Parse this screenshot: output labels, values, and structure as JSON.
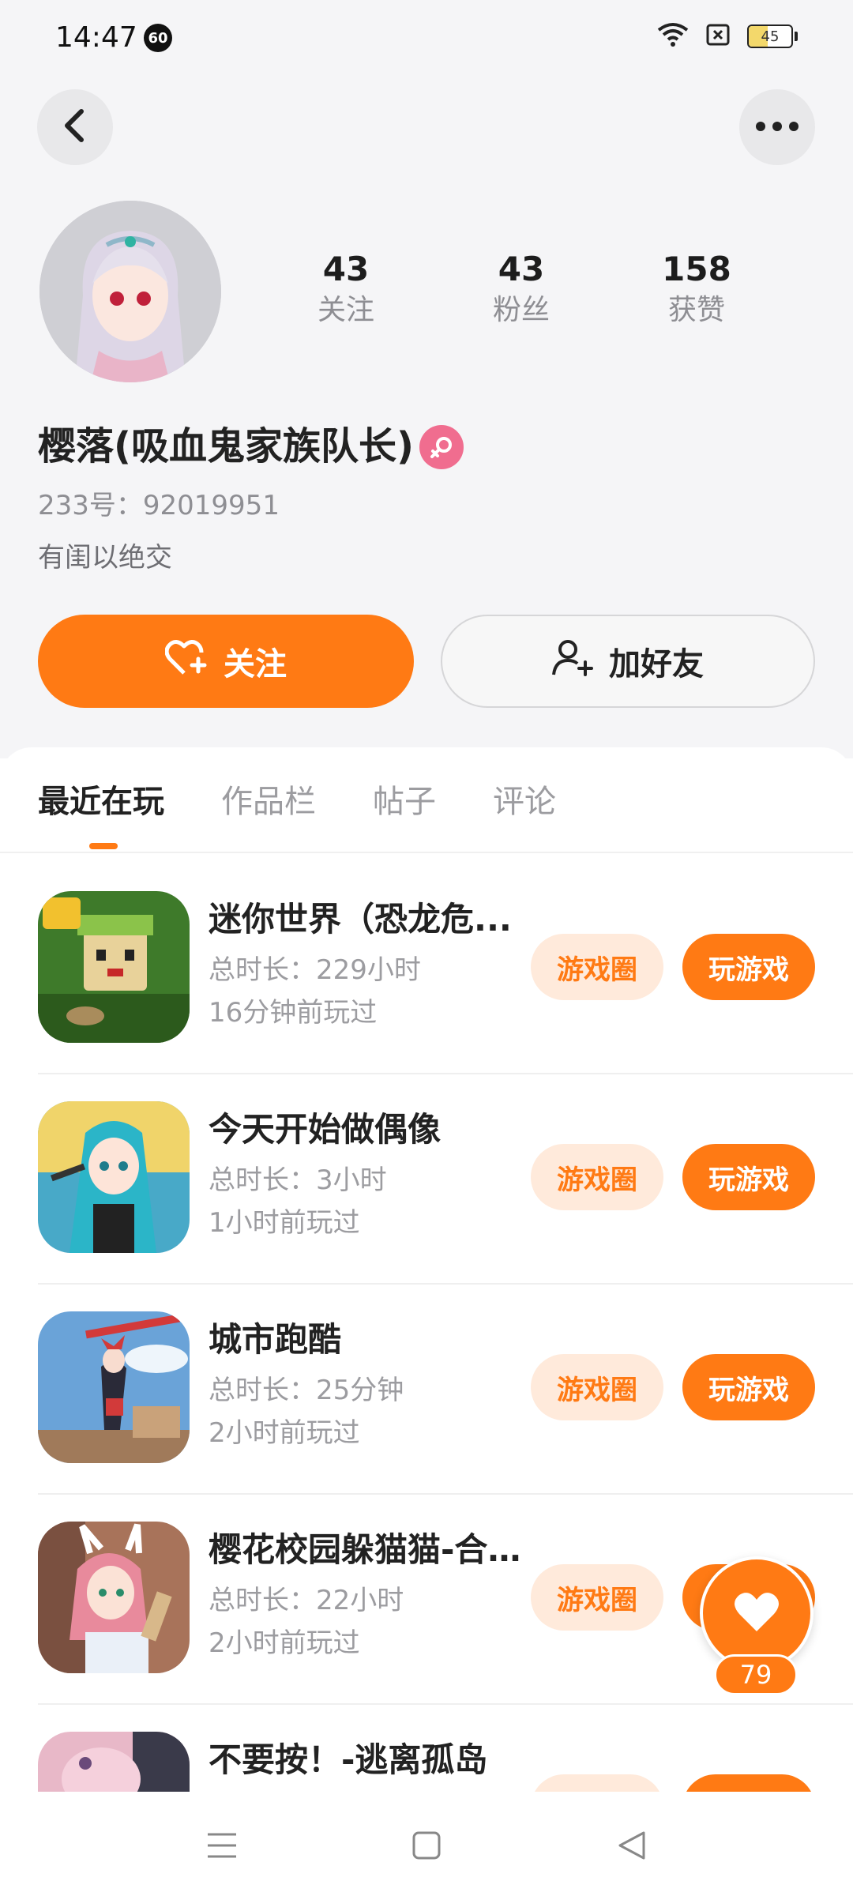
{
  "status_bar": {
    "time": "14:47",
    "badge": "60",
    "battery": "45",
    "battery_level": 0.45
  },
  "header": {
    "back_icon": "chevron-left-icon",
    "more_icon": "more-horizontal-icon"
  },
  "profile": {
    "avatar_icon": "anime-girl-avatar",
    "stats": [
      {
        "value": "43",
        "label": "关注"
      },
      {
        "value": "43",
        "label": "粉丝"
      },
      {
        "value": "158",
        "label": "获赞"
      }
    ],
    "name": "樱落(吸血鬼家族队长)",
    "gender_icon": "female-icon",
    "uid": "233号：92019951",
    "bio": "有闺以绝交",
    "follow_label": "关注",
    "add_friend_label": "加好友"
  },
  "tabs": [
    {
      "label": "最近在玩",
      "active": true
    },
    {
      "label": "作品栏",
      "active": false
    },
    {
      "label": "帖子",
      "active": false
    },
    {
      "label": "评论",
      "active": false
    }
  ],
  "games": [
    {
      "title": "迷你世界（恐龙危...",
      "duration": "总时长：229小时",
      "last_played": "16分钟前玩过",
      "circle_label": "游戏圈",
      "play_label": "玩游戏",
      "icon_color": "#3e7a2a"
    },
    {
      "title": "今天开始做偶像",
      "duration": "总时长：3小时",
      "last_played": "1小时前玩过",
      "circle_label": "游戏圈",
      "play_label": "玩游戏",
      "icon_color": "#48a9c8"
    },
    {
      "title": "城市跑酷",
      "duration": "总时长：25分钟",
      "last_played": "2小时前玩过",
      "circle_label": "游戏圈",
      "play_label": "玩游戏",
      "icon_color": "#6aa3d8"
    },
    {
      "title": "樱花校园躲猫猫-合...",
      "duration": "总时长：22小时",
      "last_played": "2小时前玩过",
      "circle_label": "游戏圈",
      "play_label": "玩游戏",
      "icon_color": "#a8735a"
    },
    {
      "title": "不要按！-逃离孤岛",
      "duration": "",
      "last_played": "",
      "circle_label": "",
      "play_label": "",
      "icon_color": "#e8b8c8"
    }
  ],
  "floating_like": {
    "count": "79",
    "icon": "heart-icon"
  },
  "nav_bar": {
    "menu_icon": "menu-icon",
    "home_icon": "home-square-icon",
    "back_icon": "back-triangle-icon"
  },
  "colors": {
    "accent": "#ff7a14",
    "accent_light": "#ffeadb",
    "female_badge": "#f06d8f"
  }
}
